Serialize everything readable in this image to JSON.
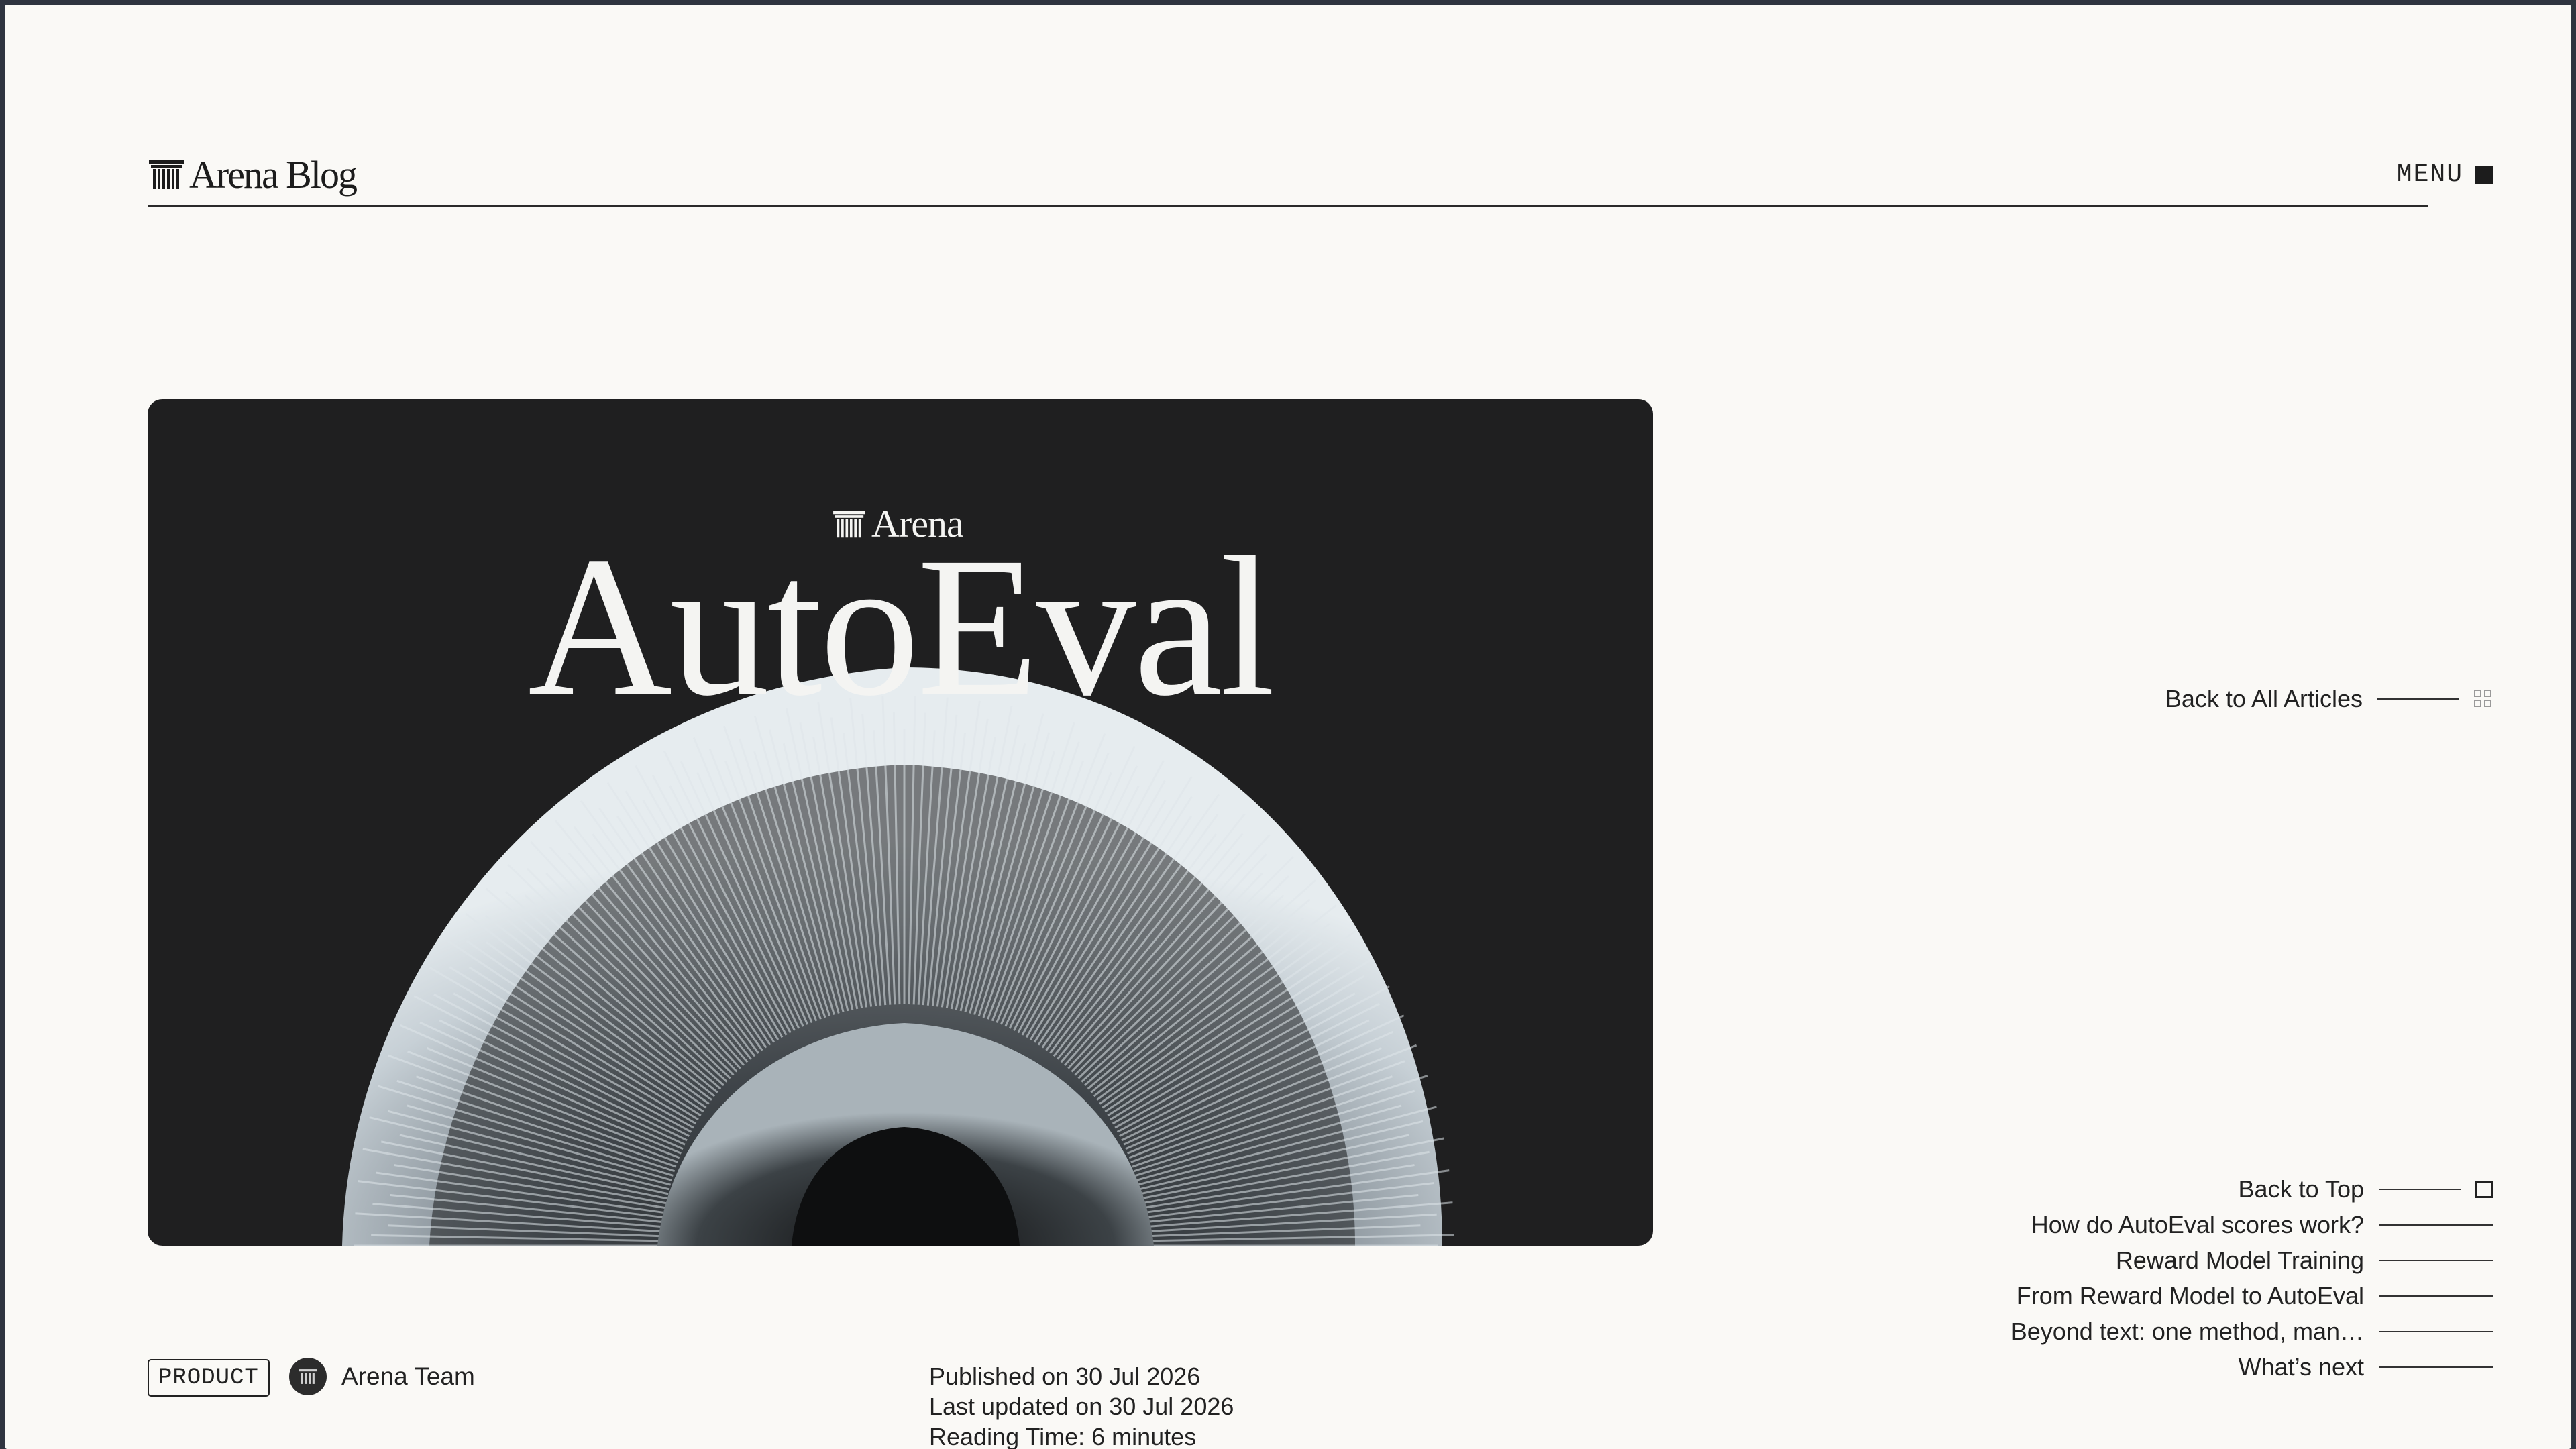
{
  "header": {
    "logo_text": "Arena Blog",
    "menu_label": "MENU"
  },
  "hero": {
    "brand": "Arena",
    "title": "AutoEval"
  },
  "nav": {
    "back_to_articles": "Back to All Articles",
    "back_to_top": "Back to Top"
  },
  "toc": [
    "How do AutoEval scores work?",
    "Reward Model Training",
    "From Reward Model to AutoEval",
    "Beyond text: one method, man…",
    "What’s next"
  ],
  "meta": {
    "tag": "PRODUCT",
    "author": "Arena Team",
    "published": "Published on 30 Jul 2026",
    "updated": "Last updated on 30 Jul 2026",
    "reading_time": "Reading Time: 6 minutes"
  },
  "colors": {
    "page_bg": "#faf9f6",
    "hero_bg": "#1f1f20",
    "frame": "#2f3440",
    "text": "#1f1f1f"
  }
}
